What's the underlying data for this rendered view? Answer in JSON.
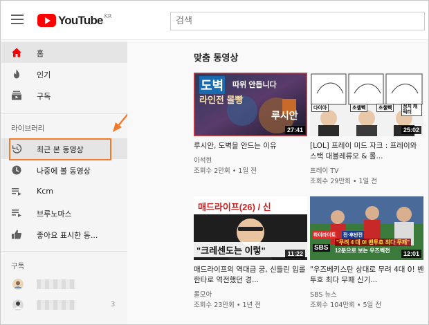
{
  "header": {
    "logo_text": "YouTube",
    "logo_region": "KR",
    "search_placeholder": "검색"
  },
  "sidebar": {
    "main_items": [
      {
        "label": "홈",
        "icon": "home-icon",
        "active": true
      },
      {
        "label": "인기",
        "icon": "flame-icon",
        "active": false
      },
      {
        "label": "구독",
        "icon": "subscriptions-icon",
        "active": false
      }
    ],
    "library_title": "라이브러리",
    "library_items": [
      {
        "label": "최근 본 동영상",
        "icon": "history-icon"
      },
      {
        "label": "나중에 볼 동영상",
        "icon": "clock-icon"
      },
      {
        "label": "Kcm",
        "icon": "playlist-icon"
      },
      {
        "label": "브루노마스",
        "icon": "playlist-icon"
      },
      {
        "label": "좋아요 표시한 동...",
        "icon": "thumbs-up-icon"
      }
    ],
    "subscriptions_title": "구독",
    "subscriptions": [
      {
        "count": ""
      },
      {
        "count": "3"
      }
    ],
    "accent_color": "#ff0000",
    "highlight_color": "#f07c2a"
  },
  "main": {
    "section_title": "맞춤 동영상",
    "videos": [
      {
        "title": "루시안, 도벽을 안드는 이유",
        "channel": "이석현",
        "meta": "조회수 2만회 • 1일 전",
        "duration": "27:41",
        "thumb_text": [
          "도벽",
          "따위 안듭니다",
          "라인전 몰빵",
          "루시안"
        ]
      },
      {
        "title": "[LOL] 프레이 미드 자크 : 프레이와 스택 대블레류오 & 롤...",
        "channel": "프레이 TV",
        "meta": "조회수 29만회 • 1일 전",
        "duration": "25:02",
        "thumb_text": [
          "다이아",
          "초챌쀅",
          "초챌쀅",
          "정치 캐릭터"
        ]
      },
      {
        "title": "매드라이프의 역대급 궁, 신들린 입롤 한타로 역전했던 경...",
        "channel": "롤모아",
        "meta": "조회수 23만회 • 1년 전",
        "duration": "11:22",
        "thumb_text": [
          "매드라이프(26) / 신",
          "\"크레센도는 이렇\""
        ]
      },
      {
        "title": "\"우즈베키스탄 상대로 무려 4대 0! 벤투호 최다 무패 신기...",
        "channel": "SBS 뉴스",
        "meta": "조회수 104만회 • 5일 전",
        "duration": "12:01",
        "thumb_text": [
          "하이라이트",
          "전·후반전",
          "\"무려 4 대 0! 벤투호 최다 무패\"",
          "12분으로 보는 우즈벡전",
          "SBS"
        ]
      }
    ]
  }
}
